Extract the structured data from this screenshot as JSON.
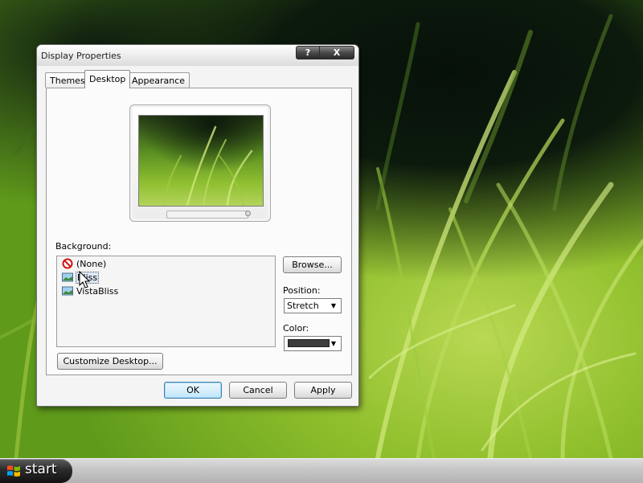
{
  "desktop": {
    "wallpaper_icon": "grass-wallpaper"
  },
  "window": {
    "title": "Display Properties",
    "help_glyph": "?",
    "close_glyph": "X",
    "tabs": [
      {
        "label": "Themes",
        "active": false
      },
      {
        "label": "Desktop",
        "active": true
      },
      {
        "label": "Appearance",
        "active": false
      }
    ],
    "desktop_tab": {
      "background_label": "Background:",
      "backgrounds": [
        {
          "label": "(None)",
          "icon": "no-symbol-icon",
          "selected": false
        },
        {
          "label": "Bliss",
          "icon": "image-file-icon",
          "selected": true
        },
        {
          "label": "VistaBliss",
          "icon": "image-file-icon",
          "selected": false
        }
      ],
      "browse_label": "Browse...",
      "position_label": "Position:",
      "position_value": "Stretch",
      "color_label": "Color:",
      "color_value": "#3c3c3c",
      "customize_label": "Customize Desktop..."
    },
    "footer": {
      "ok_label": "OK",
      "cancel_label": "Cancel",
      "apply_label": "Apply"
    }
  },
  "taskbar": {
    "start_label": "start",
    "start_icon": "windows-flag-icon"
  },
  "colors": {
    "accent_default_button": "#3c7fb1",
    "taskbar_start": "#2b2b2b"
  }
}
